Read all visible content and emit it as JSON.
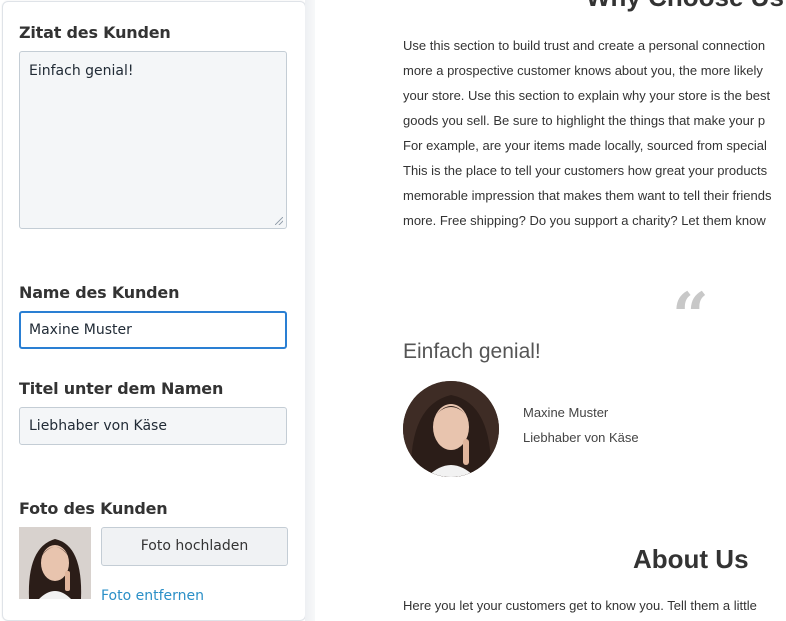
{
  "editor": {
    "quote_label": "Zitat des Kunden",
    "quote_value": "Einfach genial!",
    "name_label": "Name des Kunden",
    "name_value": "Maxine Muster",
    "title_label": "Titel unter dem Namen",
    "title_value": "Liebhaber von Käse",
    "photo_label": "Foto des Kunden",
    "upload_button": "Foto hochladen",
    "remove_link": "Foto entfernen"
  },
  "preview": {
    "section_heading": "Why Choose Us",
    "paragraph_lines": [
      "Use this section to build trust and create a personal connection",
      "more a prospective customer knows about you, the more likely",
      "your store. Use this section to explain why your store is the best",
      "goods you sell. Be sure to highlight the things that make your p",
      "For example, are your items made locally, sourced from special",
      "This is the place to tell your customers how great your products",
      "memorable impression that makes them want to tell their friends",
      "more. Free shipping? Do you support a charity? Let them know"
    ],
    "quote_mark": "“",
    "testimonial_quote": "Einfach genial!",
    "customer_name": "Maxine Muster",
    "customer_title": "Liebhaber von Käse",
    "about_heading": "About Us",
    "about_text": "Here you let your customers get to know you. Tell them a little"
  },
  "colors": {
    "focus_border": "#2a7fd3",
    "link": "#2a8fc7",
    "quote_mark": "#c8c8c8"
  }
}
